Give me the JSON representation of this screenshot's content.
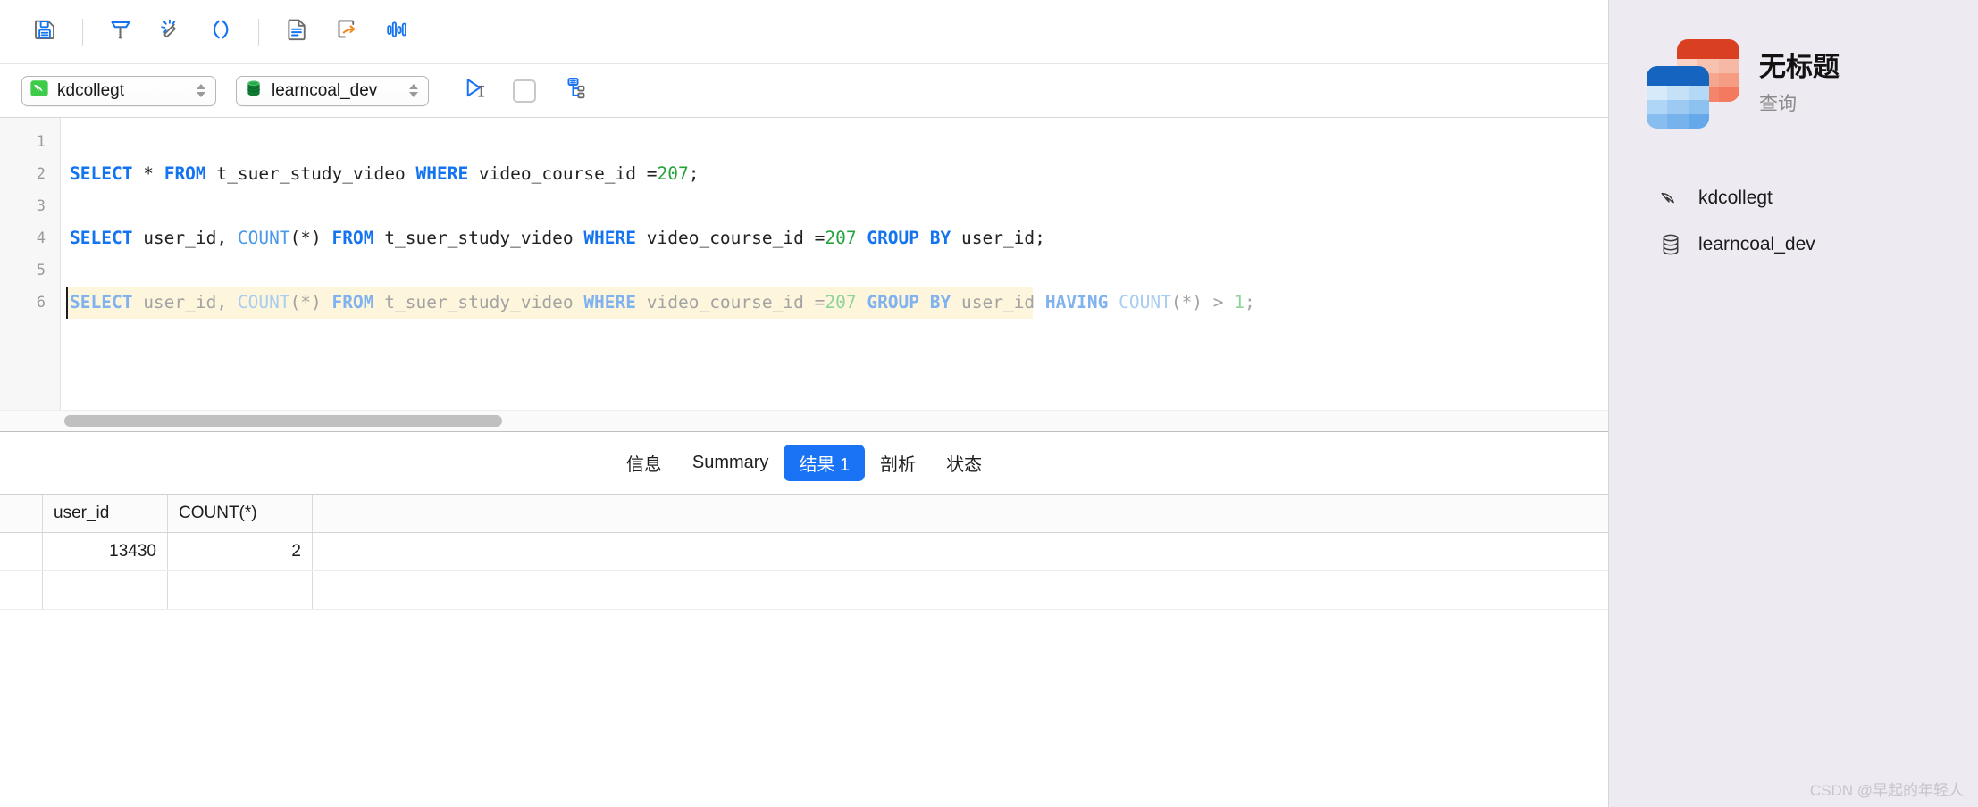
{
  "toolbar": {
    "buttons": [
      {
        "name": "save-icon",
        "label": "保存"
      },
      {
        "name": "beautify-icon",
        "label": "美化"
      },
      {
        "name": "magic-wand-icon",
        "label": "格式化"
      },
      {
        "name": "parentheses-icon",
        "label": "括号"
      },
      {
        "name": "document-icon",
        "label": "文档"
      },
      {
        "name": "export-icon",
        "label": "导出"
      },
      {
        "name": "chart-bars-icon",
        "label": "图表"
      }
    ]
  },
  "connection_bar": {
    "connection": {
      "value": "kdcollegt",
      "icon": "mysql-dolphin-icon"
    },
    "database": {
      "value": "learncoal_dev",
      "icon": "database-cylinder-icon"
    },
    "run_button_label": "运行",
    "stop_button_label": "停止",
    "explain_button_label": "执行计划"
  },
  "editor": {
    "line_numbers": [
      "1",
      "2",
      "3",
      "4",
      "5",
      "6"
    ],
    "lines": [
      {
        "n": 1,
        "highlighted": false,
        "tokens": []
      },
      {
        "n": 2,
        "highlighted": false,
        "tokens": [
          {
            "t": "SELECT",
            "c": "kw"
          },
          {
            "t": " ",
            "c": "plain"
          },
          {
            "t": "*",
            "c": "punct"
          },
          {
            "t": " ",
            "c": "plain"
          },
          {
            "t": "FROM",
            "c": "kw"
          },
          {
            "t": " t_suer_study_video ",
            "c": "plain"
          },
          {
            "t": "WHERE",
            "c": "kw"
          },
          {
            "t": " video_course_id =",
            "c": "plain"
          },
          {
            "t": "207",
            "c": "num"
          },
          {
            "t": ";",
            "c": "punct"
          }
        ]
      },
      {
        "n": 3,
        "highlighted": false,
        "tokens": []
      },
      {
        "n": 4,
        "highlighted": false,
        "tokens": [
          {
            "t": "SELECT",
            "c": "kw"
          },
          {
            "t": " user_id, ",
            "c": "plain"
          },
          {
            "t": "COUNT",
            "c": "fn"
          },
          {
            "t": "(*) ",
            "c": "punct"
          },
          {
            "t": "FROM",
            "c": "kw"
          },
          {
            "t": " t_suer_study_video ",
            "c": "plain"
          },
          {
            "t": "WHERE",
            "c": "kw"
          },
          {
            "t": " video_course_id =",
            "c": "plain"
          },
          {
            "t": "207",
            "c": "num"
          },
          {
            "t": " ",
            "c": "plain"
          },
          {
            "t": "GROUP BY",
            "c": "kw"
          },
          {
            "t": " user_id;",
            "c": "plain"
          }
        ]
      },
      {
        "n": 5,
        "highlighted": false,
        "tokens": []
      },
      {
        "n": 6,
        "highlighted": true,
        "tokens": [
          {
            "t": "SELECT",
            "c": "kw"
          },
          {
            "t": " user_id, ",
            "c": "plain"
          },
          {
            "t": "COUNT",
            "c": "fn"
          },
          {
            "t": "(*) ",
            "c": "punct"
          },
          {
            "t": "FROM",
            "c": "kw"
          },
          {
            "t": " t_suer_study_video ",
            "c": "plain"
          },
          {
            "t": "WHERE",
            "c": "kw"
          },
          {
            "t": " video_course_id =",
            "c": "plain"
          },
          {
            "t": "207",
            "c": "num"
          },
          {
            "t": " ",
            "c": "plain"
          },
          {
            "t": "GROUP BY",
            "c": "kw"
          },
          {
            "t": " user_id ",
            "c": "plain"
          },
          {
            "t": "HAVING",
            "c": "kw"
          },
          {
            "t": " ",
            "c": "plain"
          },
          {
            "t": "COUNT",
            "c": "fn"
          },
          {
            "t": "(*) > ",
            "c": "punct"
          },
          {
            "t": "1",
            "c": "num"
          },
          {
            "t": ";",
            "c": "punct"
          }
        ]
      }
    ]
  },
  "result_tabs": [
    {
      "label": "信息",
      "active": false
    },
    {
      "label": "Summary",
      "active": false
    },
    {
      "label": "结果 1",
      "active": true
    },
    {
      "label": "剖析",
      "active": false
    },
    {
      "label": "状态",
      "active": false
    }
  ],
  "result_grid": {
    "columns": [
      "user_id",
      "COUNT(*)",
      ""
    ],
    "rows": [
      {
        "user_id": "13430",
        "count": "2",
        "extra": ""
      }
    ]
  },
  "sidebar": {
    "title": "无标题",
    "subtitle": "查询",
    "items": [
      {
        "label": "kdcollegt",
        "icon": "mysql-dolphin-icon"
      },
      {
        "label": "learncoal_dev",
        "icon": "database-cylinder-icon"
      }
    ]
  },
  "watermark": "CSDN @早起的年轻人",
  "colors": {
    "accent_blue": "#1a73f5",
    "keyword_blue": "#1474f0",
    "number_green": "#25a33d",
    "sidebar_bg": "#eeeaf1",
    "highlight_line": "#fdf6dd",
    "orange": "#f08a24"
  }
}
